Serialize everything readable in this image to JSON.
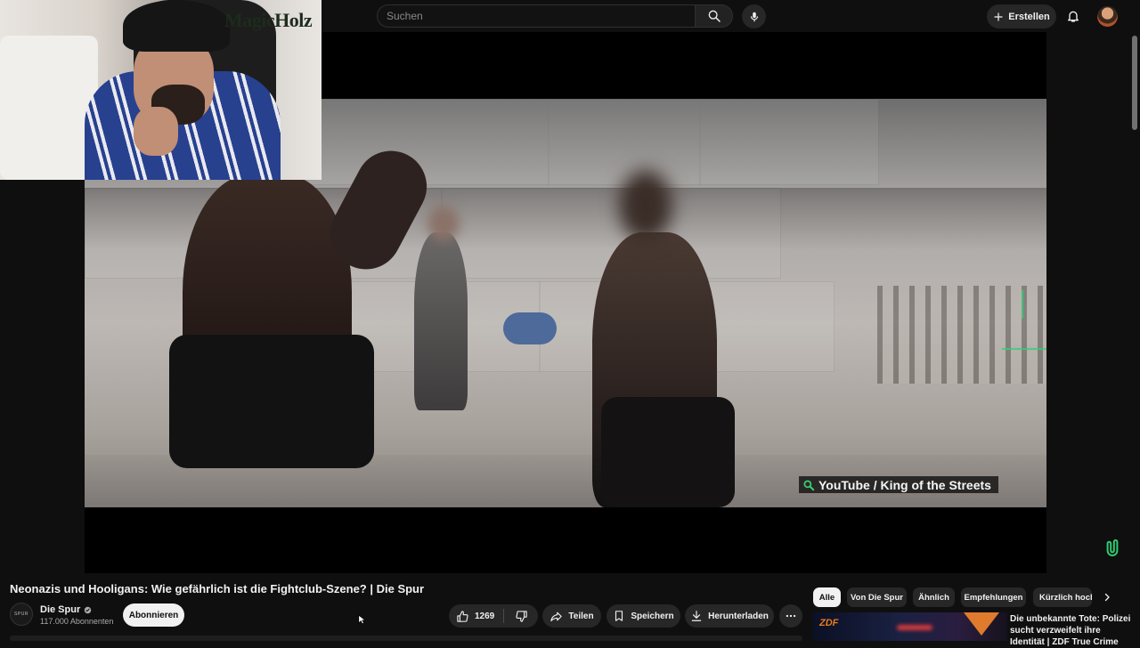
{
  "header": {
    "search_placeholder": "Suchen",
    "create_label": "Erstellen"
  },
  "webcam_overlay": {
    "brand_text": "MagicHolz"
  },
  "player": {
    "caption_text": "YouTube / King of the Streets"
  },
  "video": {
    "title": "Neonazis und Hooligans: Wie gefährlich ist die Fightclub-Szene? | Die Spur",
    "channel_name": "Die Spur",
    "channel_avatar_text": "SPUR",
    "subscribers": "117.000 Abonnenten",
    "subscribe_label": "Abonnieren",
    "like_count": "1269",
    "share_label": "Teilen",
    "save_label": "Speichern",
    "download_label": "Herunterladen"
  },
  "chips": [
    {
      "label": "Alle",
      "active": true
    },
    {
      "label": "Von Die Spur",
      "active": false
    },
    {
      "label": "Ähnlich",
      "active": false
    },
    {
      "label": "Empfehlungen",
      "active": false
    },
    {
      "label": "Kürzlich hochgeladen",
      "active": false
    }
  ],
  "recommendations": [
    {
      "channel_logo": "ZDF",
      "title": "Die unbekannte Tote: Polizei sucht verzweifelt ihre Identität | ZDF True Crime"
    }
  ],
  "colors": {
    "background": "#0f0f0f",
    "button_bg": "#272727",
    "subscribe_bg": "#f1f1f1",
    "accent_green": "#2ecc71"
  }
}
